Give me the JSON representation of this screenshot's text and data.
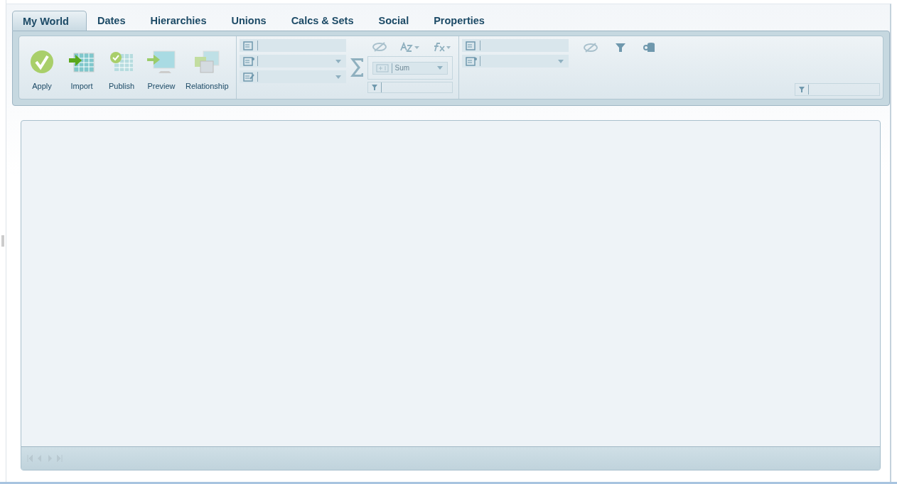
{
  "tabs": [
    {
      "label": "My World",
      "selected": true
    },
    {
      "label": "Dates",
      "selected": false
    },
    {
      "label": "Hierarchies",
      "selected": false
    },
    {
      "label": "Unions",
      "selected": false
    },
    {
      "label": "Calcs & Sets",
      "selected": false
    },
    {
      "label": "Social",
      "selected": false
    },
    {
      "label": "Properties",
      "selected": false
    }
  ],
  "ribbon_buttons": [
    {
      "kind": "apply",
      "label": "Apply"
    },
    {
      "kind": "import",
      "label": "Import"
    },
    {
      "kind": "publish",
      "label": "Publish"
    },
    {
      "kind": "preview",
      "label": "Preview"
    },
    {
      "kind": "relationship",
      "label": "Relationship"
    }
  ],
  "aggregation": {
    "value": "Sum"
  }
}
